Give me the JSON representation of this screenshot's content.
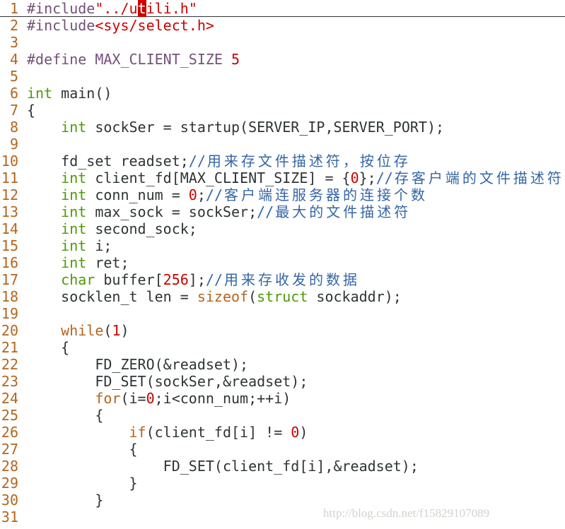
{
  "editor": {
    "cursor": {
      "line": 1,
      "column": 14
    },
    "lines": [
      [
        [
          "p",
          "#include"
        ],
        [
          "s",
          "\"../utili.h\""
        ]
      ],
      [
        [
          "p",
          "#include"
        ],
        [
          "s",
          "<sys/select.h>"
        ]
      ],
      [],
      [
        [
          "p",
          "#define MAX_CLIENT_SIZE "
        ],
        [
          "s",
          "5"
        ]
      ],
      [],
      [
        [
          "t",
          "int"
        ],
        [
          "n",
          " main()"
        ]
      ],
      [
        [
          "n",
          "{"
        ]
      ],
      [
        [
          "n",
          "    "
        ],
        [
          "t",
          "int"
        ],
        [
          "n",
          " sockSer = startup(SERVER_IP,SERVER_PORT);"
        ]
      ],
      [],
      [
        [
          "n",
          "    fd_set readset;"
        ],
        [
          "c",
          "//用来存文件描述符，按位存"
        ]
      ],
      [
        [
          "n",
          "    "
        ],
        [
          "t",
          "int"
        ],
        [
          "n",
          " client_fd[MAX_CLIENT_SIZE] = {"
        ],
        [
          "s",
          "0"
        ],
        [
          "n",
          "};"
        ],
        [
          "c",
          "//存客户端的文件描述符"
        ]
      ],
      [
        [
          "n",
          "    "
        ],
        [
          "t",
          "int"
        ],
        [
          "n",
          " conn_num = "
        ],
        [
          "s",
          "0"
        ],
        [
          "n",
          ";"
        ],
        [
          "c",
          "//客户端连服务器的连接个数"
        ]
      ],
      [
        [
          "n",
          "    "
        ],
        [
          "t",
          "int"
        ],
        [
          "n",
          " max_sock = sockSer;"
        ],
        [
          "c",
          "//最大的文件描述符"
        ]
      ],
      [
        [
          "n",
          "    "
        ],
        [
          "t",
          "int"
        ],
        [
          "n",
          " second_sock;"
        ]
      ],
      [
        [
          "n",
          "    "
        ],
        [
          "t",
          "int"
        ],
        [
          "n",
          " i;"
        ]
      ],
      [
        [
          "n",
          "    "
        ],
        [
          "t",
          "int"
        ],
        [
          "n",
          " ret;"
        ]
      ],
      [
        [
          "n",
          "    "
        ],
        [
          "t",
          "char"
        ],
        [
          "n",
          " buffer["
        ],
        [
          "s",
          "256"
        ],
        [
          "n",
          "];"
        ],
        [
          "c",
          "//用来存收发的数据"
        ]
      ],
      [
        [
          "n",
          "    socklen_t len = "
        ],
        [
          "k",
          "sizeof"
        ],
        [
          "n",
          "("
        ],
        [
          "t",
          "struct"
        ],
        [
          "n",
          " sockaddr);"
        ]
      ],
      [],
      [
        [
          "n",
          "    "
        ],
        [
          "k",
          "while"
        ],
        [
          "n",
          "("
        ],
        [
          "s",
          "1"
        ],
        [
          "n",
          ")"
        ]
      ],
      [
        [
          "n",
          "    {"
        ]
      ],
      [
        [
          "n",
          "        FD_ZERO(&readset);"
        ]
      ],
      [
        [
          "n",
          "        FD_SET(sockSer,&readset);"
        ]
      ],
      [
        [
          "n",
          "        "
        ],
        [
          "k",
          "for"
        ],
        [
          "n",
          "(i="
        ],
        [
          "s",
          "0"
        ],
        [
          "n",
          ";i<conn_num;++i)"
        ]
      ],
      [
        [
          "n",
          "        {"
        ]
      ],
      [
        [
          "n",
          "            "
        ],
        [
          "k",
          "if"
        ],
        [
          "n",
          "(client_fd[i] != "
        ],
        [
          "s",
          "0"
        ],
        [
          "n",
          ")"
        ]
      ],
      [
        [
          "n",
          "            {"
        ]
      ],
      [
        [
          "n",
          "                FD_SET(client_fd[i],&readset);"
        ]
      ],
      [
        [
          "n",
          "            }"
        ]
      ],
      [
        [
          "n",
          "        }"
        ]
      ],
      []
    ]
  },
  "watermark": "http://blog.csdn.net/f15829107089"
}
